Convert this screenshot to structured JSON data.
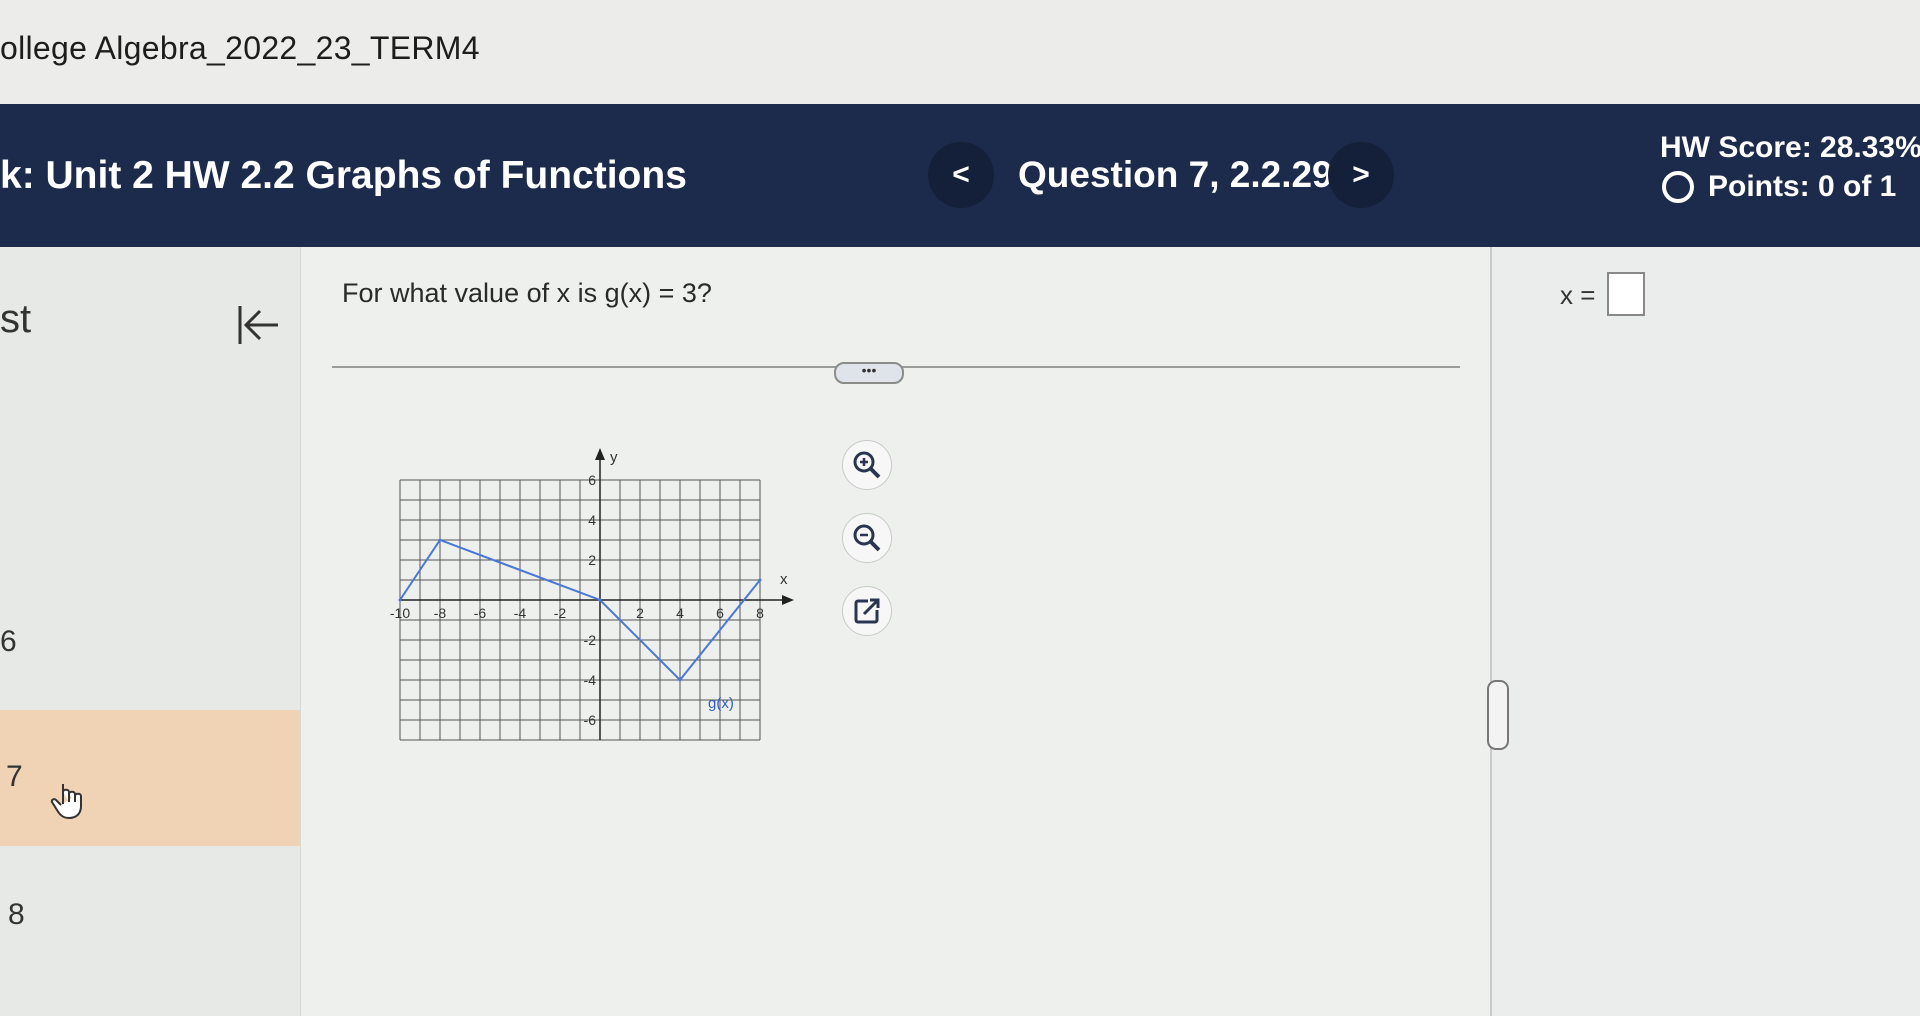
{
  "course": {
    "title": "ollege Algebra_2022_23_TERM4"
  },
  "header": {
    "title": "k:  Unit 2 HW 2.2 Graphs of Functions",
    "prev_label": "<",
    "next_label": ">",
    "question_label": "Question 7, 2.2.29",
    "hw_score": "HW Score: 28.33%",
    "points": "Points: 0 of 1"
  },
  "sidebar": {
    "heading": "st",
    "items": [
      {
        "label": "6"
      },
      {
        "label": "7"
      },
      {
        "label": "8"
      }
    ]
  },
  "question": {
    "prompt": "For what value of x is g(x) = 3?",
    "more_label": "•••"
  },
  "answer": {
    "prefix": "x =",
    "value": ""
  },
  "tools": {
    "zoom_in": "zoom-in-icon",
    "zoom_out": "zoom-out-icon",
    "popout": "popout-icon"
  },
  "graph": {
    "x_axis_label": "x",
    "y_axis_label": "y",
    "function_label": "g(x)",
    "x_ticks": [
      "-10",
      "-8",
      "-6",
      "-4",
      "-2",
      "2",
      "4",
      "6",
      "8"
    ],
    "y_ticks": [
      "6",
      "4",
      "2",
      "-2",
      "-4",
      "-6"
    ],
    "xlim": [
      -10,
      8
    ],
    "ylim": [
      -7,
      6
    ],
    "points": [
      [
        -10,
        0
      ],
      [
        -8,
        3
      ],
      [
        0,
        0
      ],
      [
        4,
        -4
      ],
      [
        8,
        1
      ]
    ],
    "line_color": "#4a78d8"
  },
  "colors": {
    "header": "#1c2a4c",
    "selected_row": "#f0d3b4"
  }
}
